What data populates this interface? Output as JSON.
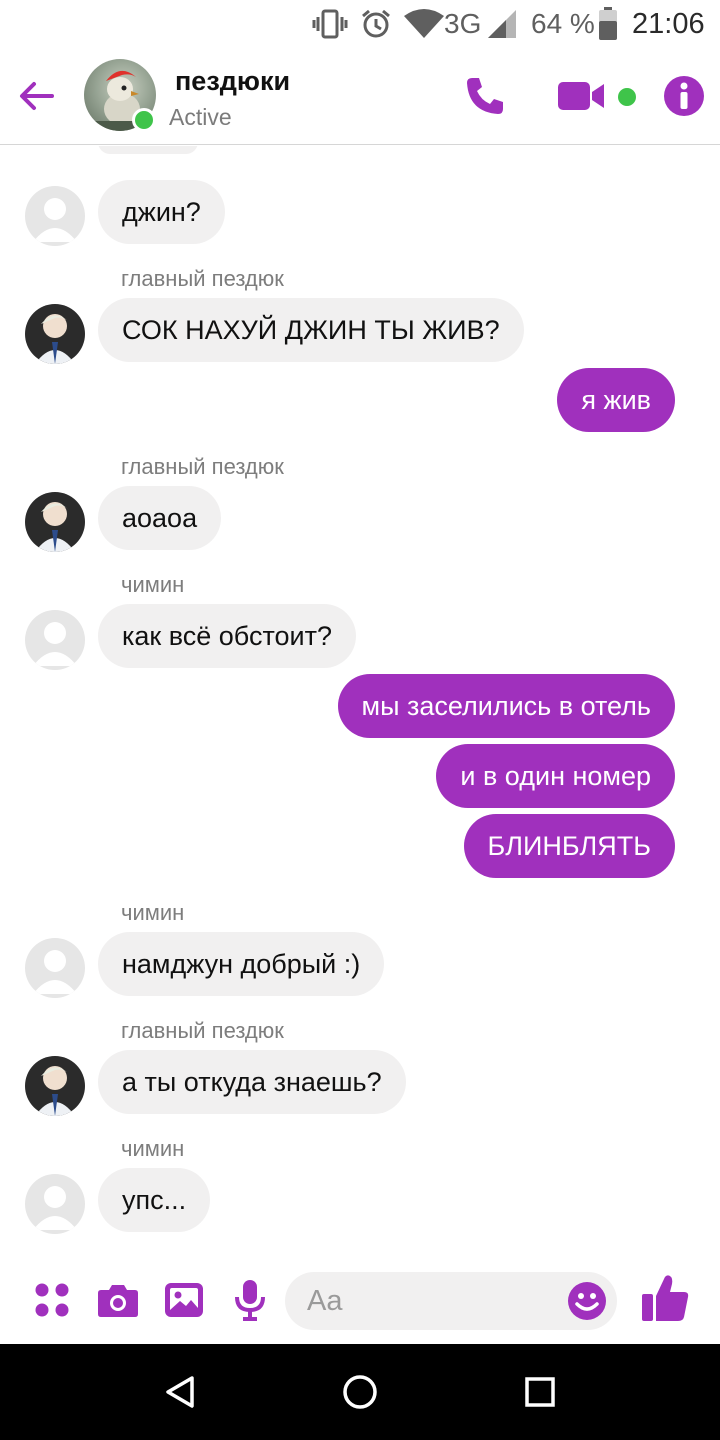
{
  "status_bar": {
    "network": "3G",
    "battery_percent": "64 %",
    "time": "21:06",
    "icons": [
      "vibrate-icon",
      "alarm-icon",
      "wifi-icon",
      "signal-icon",
      "battery-icon"
    ]
  },
  "header": {
    "title": "пездюки",
    "status": "Active",
    "icons": [
      "back-arrow-icon",
      "phone-icon",
      "video-camera-icon",
      "info-icon"
    ]
  },
  "colors": {
    "accent": "#a030bd",
    "online": "#3fc44a",
    "incoming_bubble": "#f1f0f0"
  },
  "messages": [
    {
      "direction": "in",
      "text": "джин?"
    },
    {
      "direction": "in",
      "sender": "главный пездюк",
      "text": "СОК НАХУЙ ДЖИН ТЫ ЖИВ?"
    },
    {
      "direction": "out",
      "text": "я жив"
    },
    {
      "direction": "in",
      "sender": "главный пездюк",
      "text": "аоаоа"
    },
    {
      "direction": "in",
      "sender": "чимин",
      "text": "как всё обстоит?"
    },
    {
      "direction": "out",
      "text": "мы заселились в отель"
    },
    {
      "direction": "out",
      "text": "и в один номер"
    },
    {
      "direction": "out",
      "text": "БЛИНБЛЯТЬ"
    },
    {
      "direction": "in",
      "sender": "чимин",
      "text": "намджун добрый :)"
    },
    {
      "direction": "in",
      "sender": "главный пездюк",
      "text": "а ты откуда знаешь?"
    },
    {
      "direction": "in",
      "sender": "чимин",
      "text": "упс..."
    }
  ],
  "composer": {
    "placeholder": "Aa",
    "icons": [
      "apps-icon",
      "camera-icon",
      "gallery-icon",
      "microphone-icon",
      "emoji-icon",
      "thumbs-up-icon"
    ]
  },
  "nav_bar": {
    "icons": [
      "back-triangle-icon",
      "home-circle-icon",
      "recents-square-icon"
    ]
  }
}
